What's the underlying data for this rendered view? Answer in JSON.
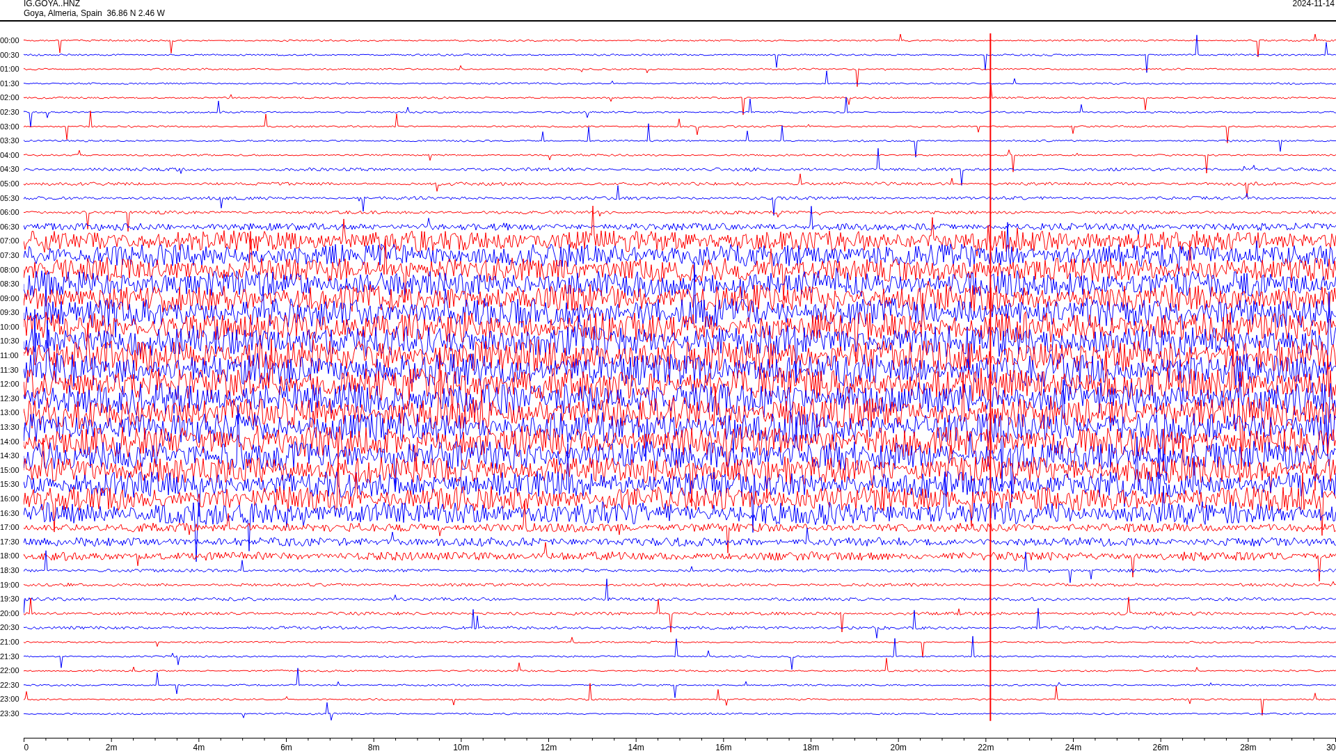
{
  "header": {
    "station": "IG.GOYA..HNZ",
    "location": "Goya, Almeria, Spain  36.86 N 2.46 W",
    "date": "2024-11-14"
  },
  "traces": [
    {
      "label": "00:00"
    },
    {
      "label": "00:30"
    },
    {
      "label": "01:00"
    },
    {
      "label": "01:30"
    },
    {
      "label": "02:00"
    },
    {
      "label": "02:30"
    },
    {
      "label": "03:00"
    },
    {
      "label": "03:30"
    },
    {
      "label": "04:00"
    },
    {
      "label": "04:30"
    },
    {
      "label": "05:00"
    },
    {
      "label": "05:30"
    },
    {
      "label": "06:00"
    },
    {
      "label": "06:30"
    },
    {
      "label": "07:00"
    },
    {
      "label": "07:30"
    },
    {
      "label": "08:00"
    },
    {
      "label": "08:30"
    },
    {
      "label": "09:00"
    },
    {
      "label": "09:30"
    },
    {
      "label": "10:00"
    },
    {
      "label": "10:30"
    },
    {
      "label": "11:00"
    },
    {
      "label": "11:30"
    },
    {
      "label": "12:00"
    },
    {
      "label": "12:30"
    },
    {
      "label": "13:00"
    },
    {
      "label": "13:30"
    },
    {
      "label": "14:00"
    },
    {
      "label": "14:30"
    },
    {
      "label": "15:00"
    },
    {
      "label": "15:30"
    },
    {
      "label": "16:00"
    },
    {
      "label": "16:30"
    },
    {
      "label": "17:00"
    },
    {
      "label": "17:30"
    },
    {
      "label": "18:00"
    },
    {
      "label": "18:30"
    },
    {
      "label": "19:00"
    },
    {
      "label": "19:30"
    },
    {
      "label": "20:00"
    },
    {
      "label": "20:30"
    },
    {
      "label": "21:00"
    },
    {
      "label": "21:30"
    },
    {
      "label": "22:00"
    },
    {
      "label": "22:30"
    },
    {
      "label": "23:00"
    },
    {
      "label": "23:30"
    }
  ],
  "x_axis": {
    "labels": [
      "0",
      "2m",
      "4m",
      "6m",
      "8m",
      "10m",
      "12m",
      "14m",
      "16m",
      "18m",
      "20m",
      "22m",
      "24m",
      "26m",
      "28m",
      "30"
    ]
  }
}
